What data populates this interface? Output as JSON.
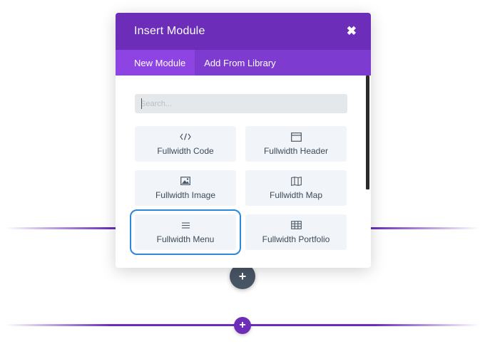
{
  "modal": {
    "title": "Insert Module",
    "close_icon": "close-x-icon",
    "tabs": [
      {
        "label": "New Module",
        "active": true
      },
      {
        "label": "Add From Library",
        "active": false
      }
    ],
    "search": {
      "placeholder": "Search...",
      "value": ""
    },
    "modules": [
      {
        "label": "Fullwidth Code",
        "icon": "code-icon"
      },
      {
        "label": "Fullwidth Header",
        "icon": "header-window-icon"
      },
      {
        "label": "Fullwidth Image",
        "icon": "image-icon"
      },
      {
        "label": "Fullwidth Map",
        "icon": "map-icon"
      },
      {
        "label": "Fullwidth Menu",
        "icon": "menu-lines-icon",
        "selected": true
      },
      {
        "label": "Fullwidth Portfolio",
        "icon": "grid-icon"
      }
    ]
  },
  "canvas": {
    "add_row_button": {
      "symbol": "+",
      "icon": "plus-icon"
    },
    "add_section_button": {
      "symbol": "+",
      "icon": "plus-icon"
    }
  },
  "colors": {
    "accent_purple": "#6c2eb9",
    "tab_bar_purple": "#7e3bd0",
    "active_tab_purple": "#8e44e2",
    "selected_outline": "#2b87da",
    "dark_button": "#485565"
  }
}
